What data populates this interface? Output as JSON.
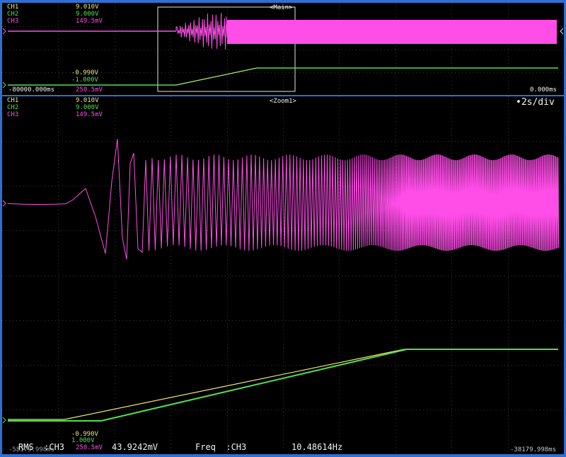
{
  "colors": {
    "ch1": "#f2e56b",
    "ch2": "#4fe04f",
    "ch3": "#ff4de8",
    "frame": "#2f6fd2",
    "grid": "#3a3a3a"
  },
  "main": {
    "title": "<Main>",
    "channels": [
      {
        "name": "CH1",
        "value": "9.010V"
      },
      {
        "name": "CH2",
        "value": "9.000V"
      },
      {
        "name": "CH3",
        "value": "149.5mV"
      }
    ],
    "levels": {
      "upper": "-0.990V",
      "lower": "-1.000V",
      "ch3_low": "250.5mV"
    },
    "time_left": "-80000.000ms",
    "time_right": "0.000ms"
  },
  "zoom": {
    "title": "<Zoom1>",
    "timebase": "2s/div",
    "channels": [
      {
        "name": "CH1",
        "value": "9.010V"
      },
      {
        "name": "CH2",
        "value": "9.000V"
      },
      {
        "name": "CH3",
        "value": "149.5mV"
      }
    ],
    "levels": {
      "upper": "-0.990V",
      "lower": "1.000V",
      "ch3_low": "250.5mV"
    },
    "time_left": "-58179.998ms",
    "time_right": "-38179.998ms"
  },
  "measurements": {
    "rms_label": "RMS  :CH3",
    "rms_value": "43.9242mV",
    "freq_label": "Freq  :CH3",
    "freq_value": "10.48614Hz"
  }
}
